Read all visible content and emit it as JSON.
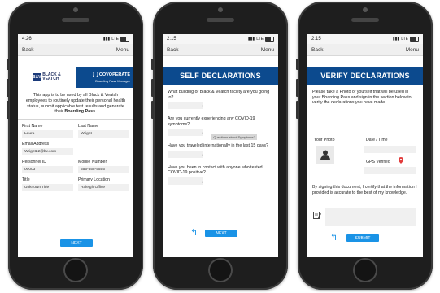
{
  "phone1": {
    "status": {
      "time": "4:26",
      "carrier": "LTE"
    },
    "nav": {
      "back": "Back",
      "menu": "Menu"
    },
    "logos": {
      "bv_abbr": "B&V",
      "bv_line1": "BLACK &",
      "bv_line2": "VEATCH",
      "co_name": "COVOPERATE",
      "co_sub": "Boarding Pass Manager"
    },
    "intro": {
      "text": "This app is to be used by all Black & Veatch employees to routinely update their personal health status, submit applicable test results and generate their",
      "bold": "Boarding Pass",
      "end": "."
    },
    "fields": {
      "first_name_label": "First Name",
      "first_name": "Laura",
      "last_name_label": "Last Name",
      "last_name": "Wright",
      "email_label": "Email Address",
      "email": "WrightL2@bv.com",
      "personnel_label": "Personnel ID",
      "personnel": "00003",
      "mobile_label": "Mobile Number",
      "mobile": "555-555-5555",
      "title_label": "Title",
      "title": "Unknown Title",
      "location_label": "Primary Location",
      "location": "Raleigh Office"
    },
    "next_label": "NEXT"
  },
  "phone2": {
    "status": {
      "time": "2:15",
      "carrier": "LTE"
    },
    "nav": {
      "back": "Back",
      "menu": "Menu"
    },
    "title": "SELF DECLARATIONS",
    "questions": [
      "What building or Black & Veatch facility are you going to?",
      "Are you currently experiencing any COVID-19 symptoms?",
      "Have you traveled internationally in the last 15 days?",
      "Have you been in contact with anyone who tested COVID-19 positive?"
    ],
    "symptoms_button": "Questions about Symptoms?",
    "next_label": "NEXT"
  },
  "phone3": {
    "status": {
      "time": "2:15",
      "carrier": "LTE"
    },
    "nav": {
      "back": "Back",
      "menu": "Menu"
    },
    "title": "VERIFY DECLARATIONS",
    "instructions": "Please take a Photo of yourself that will be used in your Boarding Pass and sign in the section below to verify the declarations you have made.",
    "photo_label": "Your Photo",
    "datetime_label": "Date / Time",
    "gps_label": "GPS Verified",
    "signing_text": "By signing this document, I certify that the information I provided is accurate to the best of my knowledge.",
    "submit_label": "SUBMIT"
  },
  "colors": {
    "brand_blue": "#0c4a8e",
    "button_blue": "#1a93e6",
    "gps_pin": "#e23b3b"
  }
}
